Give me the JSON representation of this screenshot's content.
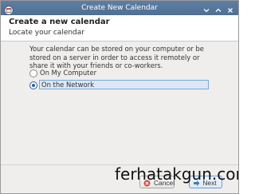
{
  "window": {
    "title": "Create New Calendar"
  },
  "header": {
    "title": "Create a new calendar",
    "subtitle": "Locate your calendar"
  },
  "content": {
    "description": "Your calendar can be stored on your computer or be stored on a server in order to access it remotely or share it with your friends or co-workers.",
    "options": [
      {
        "label": "On My Computer",
        "selected": false
      },
      {
        "label": "On the Network",
        "selected": true
      }
    ]
  },
  "footer": {
    "cancel_label": "Cancel",
    "next_label": "Next"
  },
  "watermark": {
    "text": "ferhatakgun.com"
  },
  "icons": {
    "app": "calendar-app-icon",
    "minimize": "chevron-down-icon",
    "maximize": "chevron-up-icon",
    "close": "close-icon",
    "cancel": "cancel-icon",
    "next": "arrow-right-icon"
  },
  "colors": {
    "titlebar": "#5e7fa3",
    "selection": "#dbe7f4",
    "accent": "#2b5fa0"
  }
}
